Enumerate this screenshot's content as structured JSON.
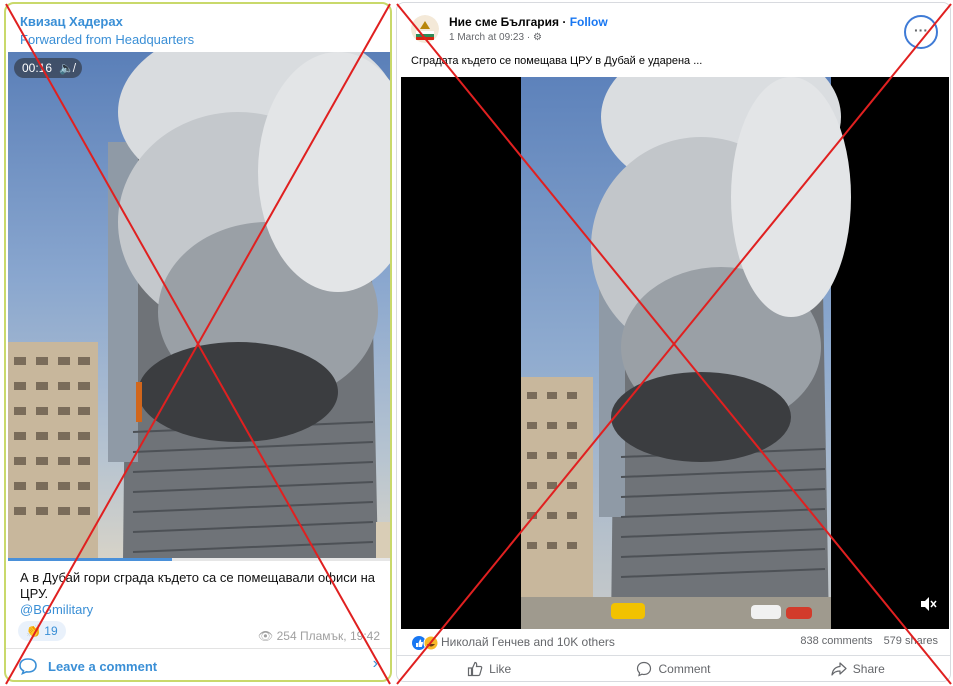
{
  "telegram": {
    "author": "Квизац Хадерах",
    "forwarded": "Forwarded from Headquarters",
    "video_duration": "00:16",
    "caption": "А в Дубай гори сграда където са се помещавали офиси на ЦРУ.",
    "handle": "@BGmilitary",
    "reaction": "👏 19",
    "views": "254",
    "channel_time": "Пламък, 19:42",
    "comment_label": "Leave a comment",
    "progress": 0.43,
    "accent_color": "#3a8fd6",
    "icons": [
      "speaker-muted-icon",
      "eye-icon",
      "comment-bubble-icon",
      "chevron-right-icon"
    ]
  },
  "facebook": {
    "page_name": "Ние сме България",
    "follow_label": "Follow",
    "timestamp": "1 March at 09:23 ·",
    "caption": "Сградата където се помещава ЦРУ в Дубай е ударена ...",
    "reaction_names": "Николай Генчев and 10K others",
    "comments_count": "838 comments",
    "shares_count": "579 shares",
    "actions": {
      "like": "Like",
      "comment": "Comment",
      "share": "Share"
    },
    "accent_color": "#1877f2",
    "icons": [
      "globe-icon",
      "more-options-icon",
      "like-reaction-icon",
      "haha-reaction-icon",
      "thumbs-up-icon",
      "comment-icon",
      "share-icon",
      "speaker-muted-icon"
    ]
  },
  "overlay": {
    "cross_color": "#e02020"
  }
}
